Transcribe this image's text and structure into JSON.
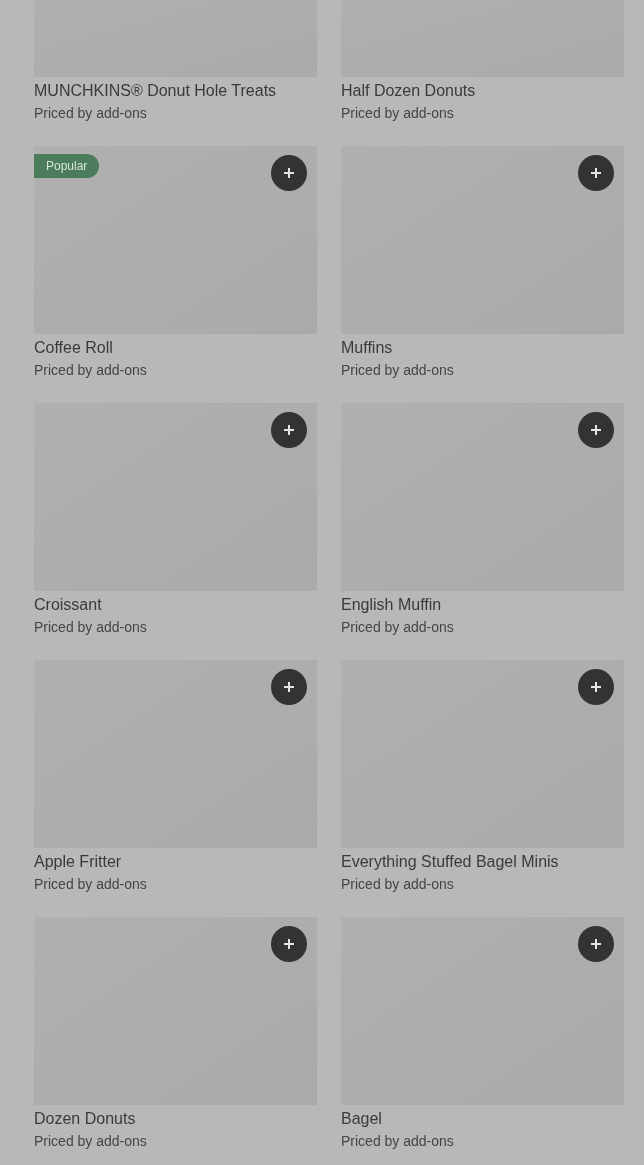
{
  "products": [
    {
      "name": "MUNCHKINS® Donut Hole Treats",
      "price": "Priced by add-ons"
    },
    {
      "name": "Half Dozen Donuts",
      "price": "Priced by add-ons"
    },
    {
      "name": "Coffee Roll",
      "price": "Priced by add-ons",
      "badge": "Popular"
    },
    {
      "name": "Muffins",
      "price": "Priced by add-ons"
    },
    {
      "name": "Croissant",
      "price": "Priced by add-ons"
    },
    {
      "name": "English Muffin",
      "price": "Priced by add-ons"
    },
    {
      "name": "Apple Fritter",
      "price": "Priced by add-ons"
    },
    {
      "name": "Everything Stuffed Bagel Minis",
      "price": "Priced by add-ons"
    },
    {
      "name": "Dozen Donuts",
      "price": "Priced by add-ons"
    },
    {
      "name": "Bagel",
      "price": "Priced by add-ons"
    }
  ]
}
